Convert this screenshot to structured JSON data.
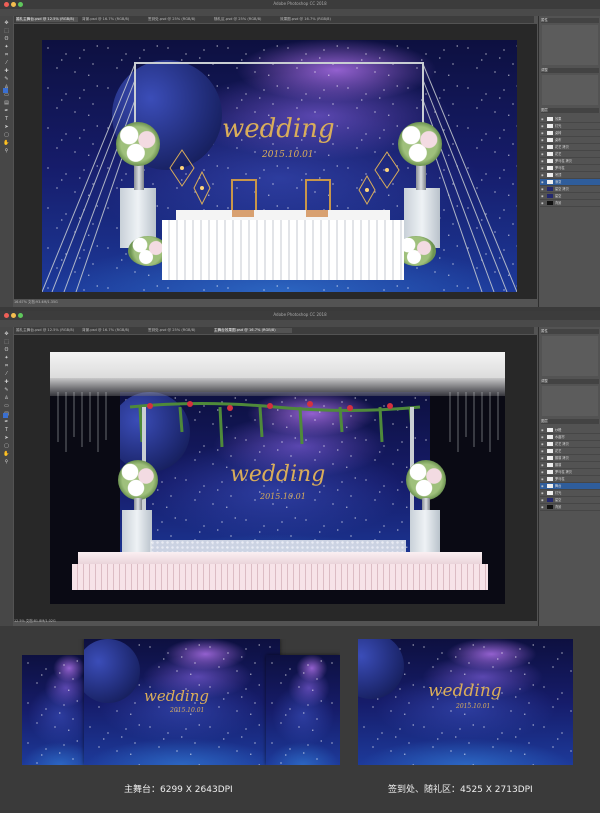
{
  "app_title": "Adobe Photoshop CC 2018",
  "window1": {
    "tabs": [
      "婚礼主舞台.psd @ 12.5% (RGB/8)",
      "背景.psd @ 16.7% (RGB/8)",
      "签到处.psd @ 25% (RGB/8)",
      "随礼区.psd @ 25% (RGB/8)",
      "效果图.psd @ 16.7% (RGB/8)"
    ],
    "status": "16.67%   文档:93.4M/1.35G",
    "panel_headers": [
      "属性",
      "调整",
      "图层"
    ],
    "layers": [
      "效果",
      "灯光",
      "桌椅",
      "桌布",
      "花艺 拷贝",
      "花艺",
      "罗马柱 拷贝",
      "罗马柱",
      "吊顶",
      "渐变",
      "星空 拷贝",
      "星空",
      "背景"
    ]
  },
  "window2": {
    "tabs": [
      "婚礼主舞台.psd @ 12.5% (RGB/8)",
      "背景.psd @ 16.7% (RGB/8)",
      "签到处.psd @ 25% (RGB/8)",
      "主舞台效果图.psd @ 16.7% (RGB/8)"
    ],
    "status": "12.5%   文档:81.8M/1.02G",
    "panel_headers": [
      "属性",
      "调整",
      "图层"
    ],
    "layers": [
      "纱幔",
      "水晶帘",
      "花艺 拷贝",
      "花艺",
      "藤蔓 拷贝",
      "藤蔓",
      "罗马柱 拷贝",
      "罗马柱",
      "舞台",
      "灯光",
      "星空",
      "背景"
    ]
  },
  "artwork": {
    "wedding_text": "wedding",
    "date_text": "2015.10.01"
  },
  "captions": {
    "main_stage": "主舞台：6299 X 2643DPI",
    "sign_area": "签到处、随礼区：4525 X 2713DPI"
  },
  "colors": {
    "gold": "#d9ad5a",
    "ui_dark": "#535353",
    "page_bg": "#3a3a3a"
  }
}
